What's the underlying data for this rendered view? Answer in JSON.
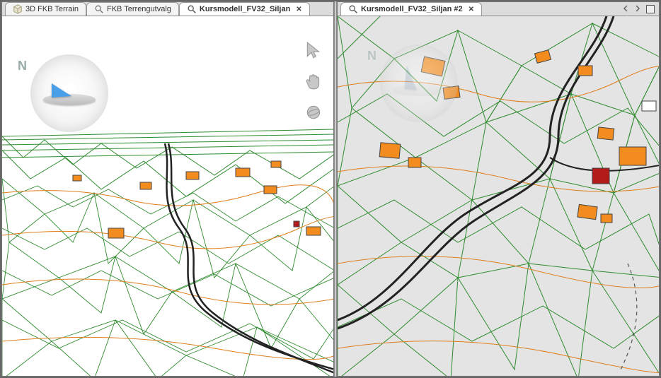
{
  "tabs": [
    {
      "label": "3D FKB Terrain",
      "icon": "cube-icon",
      "active": false,
      "closable": false
    },
    {
      "label": "FKB  Terrengutvalg",
      "icon": "magnifier-icon",
      "active": false,
      "closable": false
    },
    {
      "label": "Kursmodell_FV32_Siljan",
      "icon": "magnifier-icon",
      "active": true,
      "closable": true
    }
  ],
  "right_pane": {
    "tab": {
      "label": "Kursmodell_FV32_Siljan #2",
      "icon": "magnifier-icon",
      "active": true,
      "closable": true
    }
  },
  "compass": {
    "letter": "N"
  },
  "nav_tools": {
    "select": "select-cursor-icon",
    "pan": "pan-hand-icon",
    "orbit": "orbit-globe-icon"
  },
  "colors": {
    "mesh_green": "#2e8b2e",
    "mesh_orange": "#e07c1a",
    "mesh_black": "#222",
    "building_fill": "#f28c1e",
    "building_red": "#b31b1b",
    "right_bg": "#e4e4e4"
  }
}
